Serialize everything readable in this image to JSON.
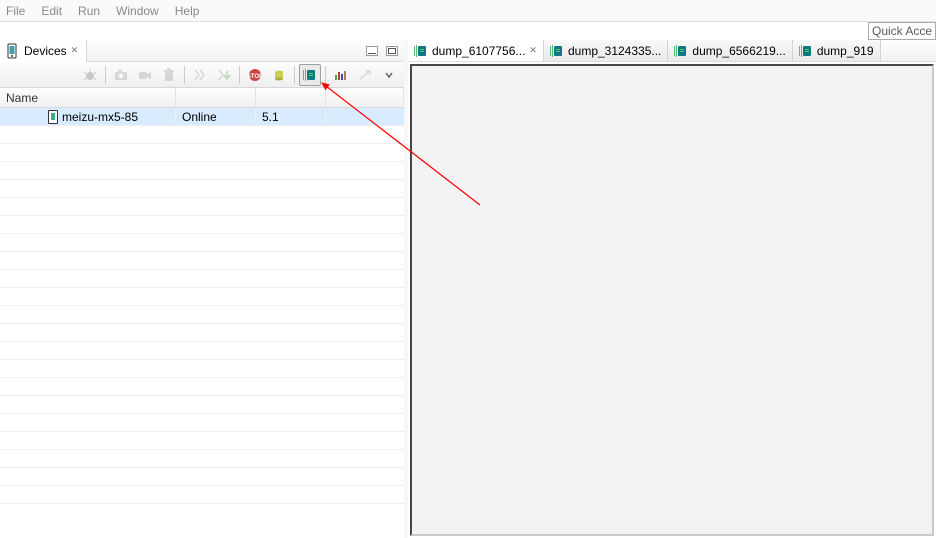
{
  "menu": {
    "items": [
      "File",
      "Edit",
      "Run",
      "Window",
      "Help"
    ]
  },
  "quick_access": {
    "text": "Quick Acce"
  },
  "devices_view": {
    "title": "Devices",
    "header": {
      "name": "Name"
    },
    "row": {
      "name": "meizu-mx5-85",
      "status": "Online",
      "version": "5.1"
    }
  },
  "editor_tabs": [
    {
      "label": "dump_6107756...",
      "active": true
    },
    {
      "label": "dump_3124335..."
    },
    {
      "label": "dump_6566219..."
    },
    {
      "label": "dump_919"
    }
  ]
}
